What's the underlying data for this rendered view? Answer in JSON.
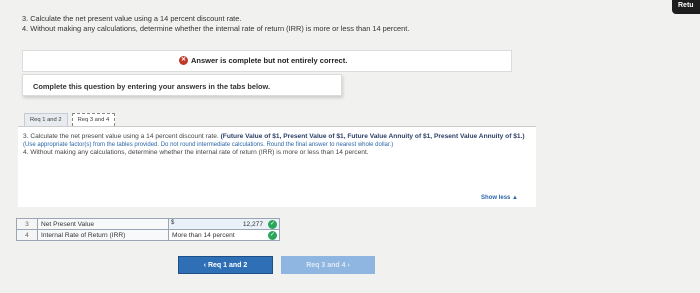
{
  "corner": {
    "label": "Retu"
  },
  "question": {
    "line3": "3. Calculate the net present value using a 14 percent discount rate.",
    "line4": "4. Without making any calculations, determine whether the internal rate of return (IRR) is more or less than 14 percent."
  },
  "status": {
    "text": "Answer is complete but not entirely correct.",
    "icon": "x-circle-icon"
  },
  "instruction": "Complete this question by entering your answers in the tabs below.",
  "tabs": [
    {
      "label": "Req 1 and 2",
      "active": false
    },
    {
      "label": "Req 3 and 4",
      "active": true
    }
  ],
  "panel": {
    "p1": "3. Calculate the net present value using a 14 percent discount rate.",
    "bold": "(Future Value of $1, Present Value of $1, Future Value Annuity of $1, Present Value Annuity of $1.)",
    "hint": "(Use appropriate factor(s) from the tables provided. Do not round intermediate calculations. Round the final answer to nearest whole dollar.)",
    "p2": "4. Without making any calculations, determine whether the internal rate of return (IRR) is more or less than 14 percent.",
    "show_less": "Show less ▲"
  },
  "table": {
    "rows": [
      {
        "num": "3",
        "label": "Net Present Value",
        "currency": "$",
        "value": "12,277"
      },
      {
        "num": "4",
        "label": "Internal Rate of Return (IRR)",
        "value": "More than 14 percent"
      }
    ]
  },
  "buttons": {
    "prev": "‹  Req 1 and 2",
    "next": "Req 3 and 4  ›"
  }
}
